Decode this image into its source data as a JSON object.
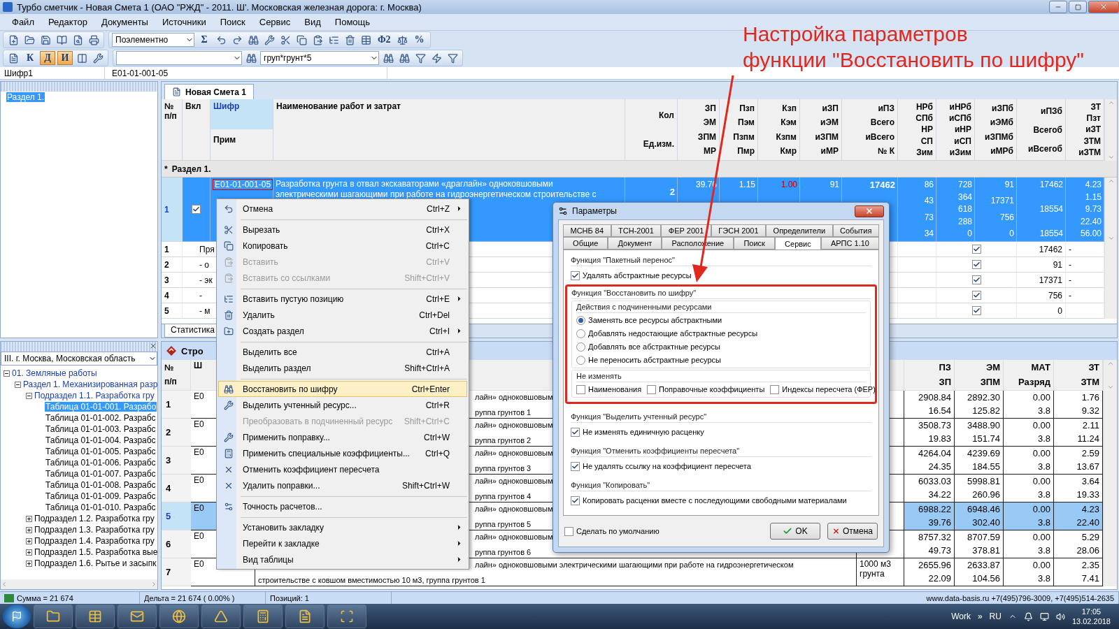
{
  "window": {
    "title": "Турбо сметчик - Новая Смета 1 (ОАО \"РЖД\" - 2011. Ш'. Московская железная дорога: г. Москва)"
  },
  "menu": [
    "Файл",
    "Редактор",
    "Документы",
    "Источники",
    "Поиск",
    "Сервис",
    "Вид",
    "Помощь"
  ],
  "toolbar1": {
    "view_select": "Поэлементно",
    "sum_button": "Σ",
    "phi_button": "Φ2",
    "percent_button": "%"
  },
  "toolbar2": {
    "buttons": [
      {
        "label": "К",
        "selected": false
      },
      {
        "label": "Д",
        "selected": true
      },
      {
        "label": "И",
        "selected": true
      }
    ],
    "search_combo": "груп*грунт*5"
  },
  "path_bar": {
    "field": "Шифр1",
    "value": "E01-01-001-05"
  },
  "left_top_tree": [
    {
      "label": "Раздел 1.",
      "selected": true
    }
  ],
  "left_bottom": {
    "region_select": "III. г. Москва, Московская область",
    "tree": [
      {
        "label": "01. Земляные работы",
        "expanded": true,
        "selected": false,
        "children": [
          {
            "label": "Раздел 1. Механизированная разр",
            "expanded": true,
            "selected": false,
            "children": [
              {
                "label": "Подраздел 1.1. Разработка гру",
                "expanded": true,
                "selected": false,
                "children": [
                  {
                    "label": "Таблица 01-01-001. Разрабо",
                    "selected": true
                  },
                  {
                    "label": "Таблица 01-01-002. Разрабс",
                    "selected": false
                  },
                  {
                    "label": "Таблица 01-01-003. Разрабс",
                    "selected": false
                  },
                  {
                    "label": "Таблица 01-01-004. Разрабс",
                    "selected": false
                  },
                  {
                    "label": "Таблица 01-01-005. Разрабс",
                    "selected": false
                  },
                  {
                    "label": "Таблица 01-01-006. Разрабс",
                    "selected": false
                  },
                  {
                    "label": "Таблица 01-01-007. Разрабс",
                    "selected": false
                  },
                  {
                    "label": "Таблица 01-01-008. Разрабс",
                    "selected": false
                  },
                  {
                    "label": "Таблица 01-01-009. Разрабс",
                    "selected": false
                  },
                  {
                    "label": "Таблица 01-01-010. Разрабс",
                    "selected": false
                  }
                ]
              },
              {
                "label": "Подраздел 1.2. Разработка гру",
                "expanded": false,
                "selected": false
              },
              {
                "label": "Подраздел 1.3. Разработка гру",
                "expanded": false,
                "selected": false
              },
              {
                "label": "Подраздел 1.4. Разработка гру",
                "expanded": false,
                "selected": false
              },
              {
                "label": "Подраздел 1.5. Разработка вые",
                "expanded": false,
                "selected": false
              },
              {
                "label": "Подраздел 1.6. Рытье и засыпк",
                "expanded": false,
                "selected": false
              }
            ]
          }
        ]
      }
    ]
  },
  "document_tab": "Новая Смета 1",
  "top_table": {
    "header_columns": [
      {
        "kind": "left",
        "labels": [
          "№",
          "п/п"
        ],
        "selected": false
      },
      {
        "kind": "left",
        "labels": [
          "Вкл"
        ],
        "selected": false
      },
      {
        "kind": "left",
        "labels": [
          "Шифр",
          "Прим"
        ],
        "selected": true
      },
      {
        "kind": "left",
        "labels": [
          "Наименование работ и затрат"
        ],
        "selected": false
      },
      {
        "kind": "right",
        "labels": [
          "Кол",
          "Ед.изм."
        ],
        "selected": false
      },
      {
        "kind": "right",
        "labels": [
          "ЗП",
          "ЭМ",
          "ЗПМ",
          "МР"
        ],
        "selected": false
      },
      {
        "kind": "right",
        "labels": [
          "Пзп",
          "Пэм",
          "Пзпм",
          "Пмр"
        ],
        "selected": false
      },
      {
        "kind": "right",
        "labels": [
          "Кзп",
          "Кэм",
          "Кзпм",
          "Кмр"
        ],
        "selected": false
      },
      {
        "kind": "right",
        "labels": [
          "иЗП",
          "иЭМ",
          "иЗПМ",
          "иМР"
        ],
        "selected": false
      },
      {
        "kind": "right",
        "labels": [
          "иПЗ",
          "Всего",
          "иВсего",
          "№ К"
        ],
        "selected": false
      },
      {
        "kind": "right",
        "labels": [
          "НРб",
          "СПб",
          "НР",
          "СП",
          "Зим"
        ],
        "selected": false
      },
      {
        "kind": "right",
        "labels": [
          "иНРб",
          "иСПб",
          "иНР",
          "иСП",
          "иЗим"
        ],
        "selected": false
      },
      {
        "kind": "right",
        "labels": [
          "иЗПб",
          "иЭМб",
          "иЗПМб",
          "иМРб"
        ],
        "selected": false
      },
      {
        "kind": "right",
        "labels": [
          "иПЗб",
          "Всегоб",
          "иВсегоб"
        ],
        "selected": false
      },
      {
        "kind": "right",
        "labels": [
          "ЗТ",
          "Пзт",
          "иЗТ",
          "ЗТМ",
          "иЗТМ"
        ],
        "selected": false
      }
    ],
    "section": {
      "marker": "*",
      "title": "Раздел 1."
    },
    "record": {
      "num": "1",
      "checked": true,
      "selected": true,
      "code": "E01-01-001-05",
      "name": [
        "Разработка грунта в отвал экскаваторами «драглайн» одноковшовыми",
        "электрическими шагающими при работе на гидроэнергетическом строительстве с"
      ],
      "qty": "2",
      "values": [
        {
          "lines": [
            "39.76"
          ]
        },
        {
          "lines": [
            "1.15"
          ]
        },
        {
          "lines": [
            "1.00"
          ]
        },
        {
          "lines": [
            "91"
          ]
        },
        {
          "lines": [
            "17462"
          ]
        },
        {
          "lines": [
            "86",
            "43",
            "73",
            "34"
          ]
        },
        {
          "lines": [
            "728",
            "364",
            "618",
            "288",
            "0"
          ]
        },
        {
          "lines": [
            "91",
            "17371",
            "756",
            "0"
          ]
        },
        {
          "lines": [
            "17462",
            "18554",
            "18554"
          ]
        },
        {
          "lines": [
            "4.23",
            "1.15",
            "9.73",
            "22.40",
            "56.00"
          ]
        }
      ]
    },
    "sub_rows": [
      {
        "num": "1",
        "text": "Пря",
        "checked": true,
        "value": "17462",
        "dash": "-"
      },
      {
        "num": "2",
        "text": "- о",
        "checked": true,
        "value": "91",
        "dash": "-"
      },
      {
        "num": "3",
        "text": "- эк",
        "checked": true,
        "value": "17371",
        "dash": "-"
      },
      {
        "num": "4",
        "text": "-",
        "checked": true,
        "value": "756",
        "dash": "-"
      },
      {
        "num": "5",
        "text": "- м",
        "checked": true,
        "value": "0"
      }
    ]
  },
  "bottom_tabs": [
    "Статистика"
  ],
  "bottom_panel": {
    "title": "Стро",
    "header": {
      "num": [
        "№",
        "п/п"
      ],
      "code": "Ш",
      "values": [
        [
          "ПЗ",
          "ЗП"
        ],
        [
          "ЭМ",
          "ЗПМ"
        ],
        [
          "МАТ",
          "Разряд"
        ],
        [
          "ЗТ",
          "ЗТМ"
        ]
      ]
    },
    "rows": [
      {
        "num": "1",
        "code": "E0",
        "selected": false,
        "name": [
          {
            "text": "лайн» одноковшовым",
            "covered": true
          },
          {
            "text": "руппа грунтов 1",
            "covered": true
          }
        ],
        "values": [
          [
            "2908.84",
            "16.54"
          ],
          [
            "2892.30",
            "125.82"
          ],
          [
            "0.00",
            "3.8"
          ],
          [
            "1.76",
            "9.32"
          ]
        ]
      },
      {
        "num": "2",
        "code": "E0",
        "selected": false,
        "name": [
          {
            "text": "лайн» одноковшовым",
            "covered": true
          },
          {
            "text": "руппа грунтов 2",
            "covered": true
          }
        ],
        "values": [
          [
            "3508.73",
            "19.83"
          ],
          [
            "3488.90",
            "151.74"
          ],
          [
            "0.00",
            "3.8"
          ],
          [
            "2.11",
            "11.24"
          ]
        ]
      },
      {
        "num": "3",
        "code": "E0",
        "selected": false,
        "name": [
          {
            "text": "лайн» одноковшовым",
            "covered": true
          },
          {
            "text": "руппа грунтов 3",
            "covered": true
          }
        ],
        "values": [
          [
            "4264.04",
            "24.35"
          ],
          [
            "4239.69",
            "184.55"
          ],
          [
            "0.00",
            "3.8"
          ],
          [
            "2.59",
            "13.67"
          ]
        ]
      },
      {
        "num": "4",
        "code": "E0",
        "selected": false,
        "name": [
          {
            "text": "лайн» одноковшовым",
            "covered": true
          },
          {
            "text": "руппа грунтов 4",
            "covered": true
          }
        ],
        "values": [
          [
            "6033.03",
            "34.22"
          ],
          [
            "5998.81",
            "260.96"
          ],
          [
            "0.00",
            "3.8"
          ],
          [
            "3.64",
            "19.33"
          ]
        ]
      },
      {
        "num": "5",
        "code": "E0",
        "selected": true,
        "name": [
          {
            "text": "лайн» одноковшовым",
            "covered": true
          },
          {
            "text": "руппа грунтов 5",
            "covered": true
          }
        ],
        "values": [
          [
            "6988.22",
            "39.76"
          ],
          [
            "6948.46",
            "302.40"
          ],
          [
            "0.00",
            "3.8"
          ],
          [
            "4.23",
            "22.40"
          ]
        ]
      },
      {
        "num": "6",
        "code": "E0",
        "selected": false,
        "name": [
          {
            "text": "лайн» одноковшовым",
            "covered": true
          },
          {
            "text": "руппа грунтов 6",
            "covered": true
          }
        ],
        "values": [
          [
            "8757.32",
            "49.73"
          ],
          [
            "8707.59",
            "378.81"
          ],
          [
            "0.00",
            "3.8"
          ],
          [
            "5.29",
            "28.06"
          ]
        ]
      },
      {
        "num": "7",
        "code": "E0",
        "selected": false,
        "name": [
          {
            "text": "лайн» одноковшовыми электрическими шагающими при работе на гидроэнергетическом",
            "covered": true
          },
          {
            "text": "строительстве с ковшом вместимостью 10 м3, группа грунтов 1"
          }
        ],
        "unit": "1000 м3 грунта",
        "values": [
          [
            "2655.96",
            "22.09"
          ],
          [
            "2633.87",
            "104.56"
          ],
          [
            "0.00",
            "3.8"
          ],
          [
            "2.35",
            "7.41"
          ]
        ]
      }
    ]
  },
  "context_menu": {
    "items": [
      {
        "kind": "item",
        "label": "Отмена",
        "shortcut": "Ctrl+Z",
        "submenu": true,
        "disabled": false,
        "selected": false
      },
      {
        "kind": "separator"
      },
      {
        "kind": "item",
        "label": "Вырезать",
        "shortcut": "Ctrl+X",
        "submenu": false,
        "disabled": false,
        "selected": false
      },
      {
        "kind": "item",
        "label": "Копировать",
        "shortcut": "Ctrl+C",
        "submenu": false,
        "disabled": false,
        "selected": false
      },
      {
        "kind": "item",
        "label": "Вставить",
        "shortcut": "Ctrl+V",
        "submenu": false,
        "disabled": true,
        "selected": false
      },
      {
        "kind": "item",
        "label": "Вставить со ссылками",
        "shortcut": "Shift+Ctrl+V",
        "submenu": false,
        "disabled": true,
        "selected": false
      },
      {
        "kind": "separator"
      },
      {
        "kind": "item",
        "label": "Вставить пустую позицию",
        "shortcut": "Ctrl+E",
        "submenu": true,
        "disabled": false,
        "selected": false
      },
      {
        "kind": "item",
        "label": "Удалить",
        "shortcut": "Ctrl+Del",
        "submenu": false,
        "disabled": false,
        "selected": false
      },
      {
        "kind": "item",
        "label": "Создать раздел",
        "shortcut": "Ctrl+I",
        "submenu": true,
        "disabled": false,
        "selected": false
      },
      {
        "kind": "separator"
      },
      {
        "kind": "item",
        "label": "Выделить все",
        "shortcut": "Ctrl+A",
        "submenu": false,
        "disabled": false,
        "selected": false
      },
      {
        "kind": "item",
        "label": "Выделить раздел",
        "shortcut": "Shift+Ctrl+A",
        "submenu": false,
        "disabled": false,
        "selected": false
      },
      {
        "kind": "separator"
      },
      {
        "kind": "item",
        "label": "Восстановить по шифру",
        "shortcut": "Ctrl+Enter",
        "submenu": false,
        "disabled": false,
        "selected": true
      },
      {
        "kind": "item",
        "label": "Выделить учтенный ресурс...",
        "shortcut": "Ctrl+R",
        "submenu": false,
        "disabled": false,
        "selected": false
      },
      {
        "kind": "item",
        "label": "Преобразовать в подчиненный ресурс",
        "shortcut": "Shift+Ctrl+C",
        "submenu": false,
        "disabled": true,
        "selected": false
      },
      {
        "kind": "item",
        "label": "Применить поправку...",
        "shortcut": "Ctrl+W",
        "submenu": false,
        "disabled": false,
        "selected": false
      },
      {
        "kind": "item",
        "label": "Применить специальные коэффициенты...",
        "shortcut": "Ctrl+Q",
        "submenu": false,
        "disabled": false,
        "selected": false
      },
      {
        "kind": "item",
        "label": "Отменить коэффициент пересчета",
        "submenu": false,
        "disabled": false,
        "selected": false
      },
      {
        "kind": "item",
        "label": "Удалить поправки...",
        "shortcut": "Shift+Ctrl+W",
        "submenu": false,
        "disabled": false,
        "selected": false
      },
      {
        "kind": "separator"
      },
      {
        "kind": "item",
        "label": "Точность расчетов...",
        "submenu": false,
        "disabled": false,
        "selected": false
      },
      {
        "kind": "separator"
      },
      {
        "kind": "item",
        "label": "Установить закладку",
        "submenu": true,
        "disabled": false,
        "selected": false
      },
      {
        "kind": "item",
        "label": "Перейти к закладке",
        "submenu": true,
        "disabled": false,
        "selected": false
      },
      {
        "kind": "item",
        "label": "Вид таблицы",
        "submenu": true,
        "disabled": false,
        "selected": false
      }
    ]
  },
  "dialog": {
    "title": "Параметры",
    "tab_rows": [
      [
        {
          "label": "МСНБ 84",
          "selected": false
        },
        {
          "label": "ТСН-2001",
          "selected": false
        },
        {
          "label": "ФЕР 2001",
          "selected": false
        },
        {
          "label": "ГЭСН 2001",
          "selected": false
        },
        {
          "label": "Определители",
          "selected": false
        },
        {
          "label": "События",
          "selected": false
        }
      ],
      [
        {
          "label": "Общие",
          "selected": false
        },
        {
          "label": "Документ",
          "selected": false
        },
        {
          "label": "Расположение",
          "selected": false
        },
        {
          "label": "Поиск",
          "selected": false
        },
        {
          "label": "Сервис",
          "selected": true
        },
        {
          "label": "АРПС 1.10",
          "selected": false
        }
      ]
    ],
    "batch_group": {
      "title": "Функция \"Пакетный перенос\"",
      "options": [
        {
          "label": "Удалять абстрактные ресурсы",
          "checked": true
        }
      ]
    },
    "restore_group": {
      "title": "Функция \"Восстановить по шифру\"",
      "highlighted": true,
      "actions_title": "Действия с подчиненными ресурсами",
      "actions": [
        {
          "label": "Заменять все ресурсы абстрактными",
          "selected": true
        },
        {
          "label": "Добавлять недостающие абстрактные ресурсы",
          "selected": false
        },
        {
          "label": "Добавлять все абстрактные ресурсы",
          "selected": false
        },
        {
          "label": "Не переносить абстрактные ресурсы",
          "selected": false
        }
      ],
      "keep_title": "Не изменять",
      "keep": [
        {
          "label": "Наименования",
          "checked": false
        },
        {
          "label": "Поправочные коэффициенты",
          "checked": false
        },
        {
          "label": "Индексы пересчета (ФЕР)",
          "checked": false
        }
      ]
    },
    "other_groups": [
      {
        "title": "Функция \"Выделить учтенный ресурс\"",
        "options": [
          {
            "label": "Не изменять единичную расценку",
            "checked": true
          }
        ]
      },
      {
        "title": "Функция \"Отменить коэффициенты пересчета\"",
        "options": [
          {
            "label": "Не удалять ссылку на коэффициент пересчета",
            "checked": true
          }
        ]
      },
      {
        "title": "Функция \"Копировать\"",
        "options": [
          {
            "label": "Копировать расценки вместе с последующими свободными материалами",
            "checked": true
          }
        ]
      }
    ],
    "default_option": {
      "label": "Сделать по умолчанию",
      "checked": false
    },
    "ok_button": "OK",
    "cancel_button": "Отмена"
  },
  "annotation": {
    "lines": [
      "Настройка параметров",
      "функции \"Восстановить по шифру\""
    ]
  },
  "status_bar": {
    "sum": "Сумма = 21 674",
    "delta": "Дельта = 21 674 ( 0.00% )",
    "positions": "Позиций: 1",
    "contacts": "www.data-basis.ru  +7(495)796-3009, +7(495)514-2635"
  },
  "taskbar": {
    "user": "Work",
    "more": "»",
    "language": "RU",
    "time": "17:05",
    "date": "13.02.2018"
  }
}
